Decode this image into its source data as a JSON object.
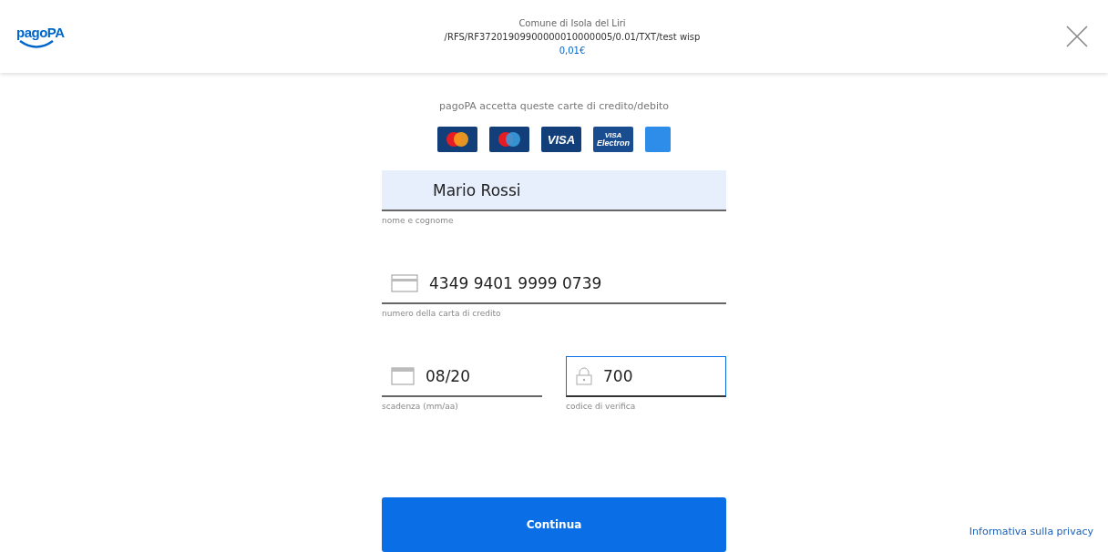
{
  "header": {
    "logo": "pagoPA",
    "payee": "Comune di Isola del Liri",
    "reference": "/RFS/RF37201909900000010000005/0.01/TXT/test wisp",
    "amount": "0,01€"
  },
  "cards_caption": "pagoPA accetta queste carte di credito/debito",
  "cards": [
    {
      "kind": "mastercard"
    },
    {
      "kind": "maestro"
    },
    {
      "kind": "visa",
      "label": "VISA"
    },
    {
      "kind": "electron",
      "label": "VISA",
      "sublabel": "Electron"
    },
    {
      "kind": "amex"
    }
  ],
  "fields": [
    {
      "kind": "name",
      "value": "Mario Rossi",
      "label": "nome e cognome",
      "autofilled": true,
      "focused": false
    },
    {
      "kind": "card",
      "value": "4349 9401 9999 0739",
      "label": "numero della carta di credito",
      "autofilled": false,
      "focused": false
    },
    {
      "kind": "expiry",
      "value": "08/20",
      "label": "scadenza (mm/aa)",
      "autofilled": false,
      "focused": false
    },
    {
      "kind": "cvv",
      "value": "700",
      "label": "codice di verifica",
      "autofilled": false,
      "focused": true
    }
  ],
  "submit": "Continua",
  "privacy_link": "Informativa sulla privacy"
}
